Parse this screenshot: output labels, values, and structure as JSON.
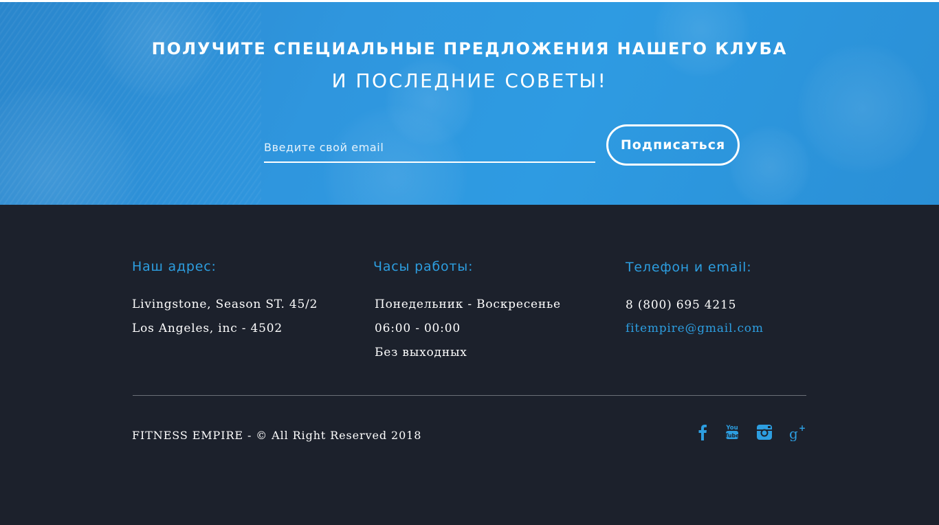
{
  "newsletter": {
    "title_line1": "ПОЛУЧИТЕ СПЕЦИАЛЬНЫЕ ПРЕДЛОЖЕНИЯ НАШЕГО КЛУБА",
    "title_line2": "И ПОСЛЕДНИЕ СОВЕТЫ!",
    "email_placeholder": "Введите свой email",
    "email_value": "",
    "subscribe_label": "Подписаться"
  },
  "footer": {
    "address": {
      "title": "Наш адрес:",
      "lines": [
        "Livingstone, Season ST. 45/2",
        "Los Angeles, inc - 4502"
      ]
    },
    "hours": {
      "title": "Часы работы:",
      "lines": [
        "Понедельник - Воскресенье",
        "06:00 - 00:00",
        "Без выходных"
      ]
    },
    "contact": {
      "title": "Телефон и email:",
      "phone": "8 (800) 695 4215",
      "email": "fitempire@gmail.com"
    },
    "copyright": "FITNESS EMPIRE -  © All Right Reserved 2018",
    "social": [
      {
        "icon": "facebook-icon"
      },
      {
        "icon": "youtube-icon"
      },
      {
        "icon": "instagram-icon"
      },
      {
        "icon": "google-plus-icon"
      }
    ]
  },
  "colors": {
    "banner_blue": "#2f96de",
    "footer_bg": "#1c212c",
    "accent": "#2d9ee0",
    "text": "#ffffff",
    "divider": "#6b7079"
  }
}
